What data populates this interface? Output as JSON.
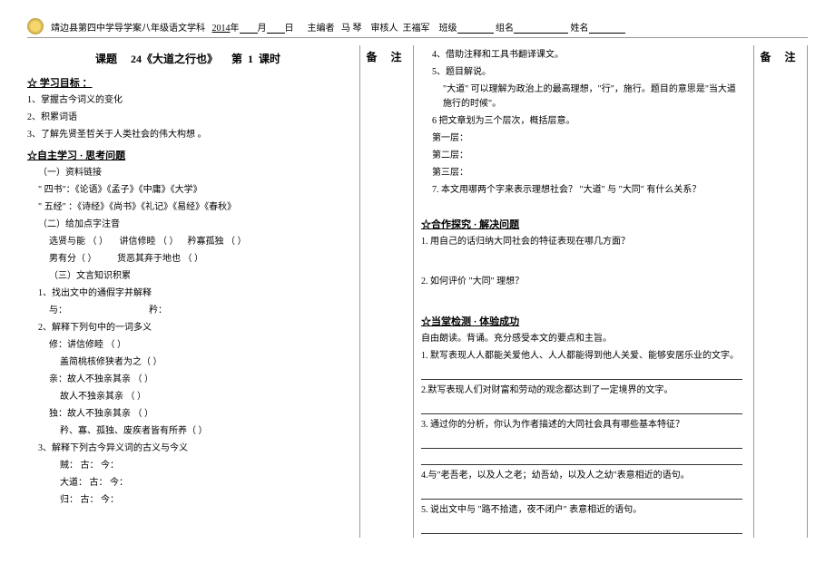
{
  "header": {
    "school": "靖边县第四中学导学案八年级语文学科",
    "year": "2014",
    "year_label": "年",
    "month_label": "月",
    "day_label": "日",
    "editor_label": "主编者",
    "editor": "马 琴",
    "reviewer_label": "审核人",
    "reviewer": "王福军",
    "class_label": "班级",
    "group_label": "组名",
    "name_label": "姓名"
  },
  "title": {
    "topic_label": "课题",
    "topic": "24《大道之行也》",
    "period_label": "第",
    "period_num": "1",
    "period_unit": "课时"
  },
  "note_label": "备 注",
  "left": {
    "goal_head": "☆ 学习目标 ：",
    "goal1": "1、掌握古今词义的变化",
    "goal2": "2、积累词语",
    "goal3": "3、了解先贤圣哲关于人类社会的伟大构想 。",
    "selfstudy_head": "☆自主学习 · 思考问题",
    "res_head": "（一）资料链接",
    "res1": "\" 四书\"：《论语》《孟子》《中庸》《大学》",
    "res2": "\"  五经\"  ：《诗经》《尚书》《礼记》《易经》《春秋》",
    "phon_head": "（二）给加点字注音",
    "phon1a": "选贤与能 （        ）",
    "phon1b": "讲信修睦 （        ）",
    "phon1c": "矜寡孤独 （        ）",
    "phon2a": "男有分（        ）",
    "phon2b": "货恶其弃于地也 （        ）",
    "gram_head": "（三）文言知识积累",
    "g1": "1、找出文中的通假字并解释",
    "g1a": "与：",
    "g1b": "矜：",
    "g2": "2、解释下列句中的一词多义",
    "g2_xiu": "修：讲信修睦  （           ）",
    "g2_xiu2": "盖简桃核修狭者为之（           ）",
    "g2_qin": "亲：故人不独亲其亲 （           ）",
    "g2_qin2": "故人不独亲其亲 （           ）",
    "g2_du": "独：故人不独亲其亲 （           ）",
    "g2_du2": "矜、寡、孤独、废疾者皆有所养（           ）",
    "g3": "3、解释下列古今异义词的古义与今义",
    "g3_e1": "贼：    古：                          今：",
    "g3_e2": "大道：  古：                          今：",
    "g3_e3": "归：    古：                          今："
  },
  "right": {
    "r4": "4、借助注释和工具书翻译课文。",
    "r5": "5、题目解说。",
    "r5_text": "\"大道\" 可以理解为政治上的最高理想，\"行\"，施行。题目的意思是\"当大道施行的时候\"。",
    "r6": "6  把文章划为三个层次，概括层意。",
    "r6_l1": "第一层：",
    "r6_l2": "第二层：",
    "r6_l3": "第三层：",
    "r7": "7. 本文用哪两个字来表示理想社会？ \"大道\" 与 \"大同\" 有什么关系？",
    "coop_head": "☆合作探究 · 解决问题",
    "c1": "1.  用自己的话归纳大同社会的特征表现在哪几方面？",
    "c2": "2.  如何评价 \"大同\"  理想？",
    "test_head": "☆当堂检测 · 体验成功",
    "test_intro": "自由朗读。背诵。充分感受本文的要点和主旨。",
    "t1": "1. 默写表现人人都能关爱他人、人人都能得到他人关爱、能够安居乐业的文字。",
    "t2": "2.默写表现人们对财富和劳动的观念都达到了一定境界的文字。",
    "t3": "3. 通过你的分析，你认为作者描述的大同社会具有哪些基本特征？",
    "t4": "4.与\"老吾老，以及人之老；幼吾幼，以及人之幼\"表意相近的语句。",
    "t5": "5. 说出文中与 \"路不拾遗，夜不闭户\"  表意相近的语句。"
  }
}
